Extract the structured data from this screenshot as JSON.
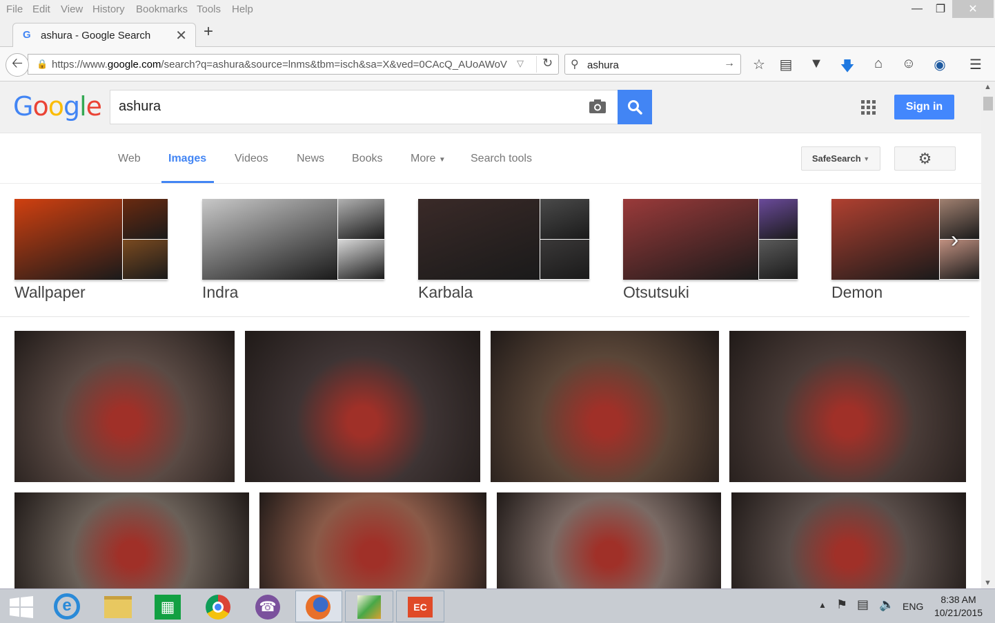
{
  "browser": {
    "menu": [
      "File",
      "Edit",
      "View",
      "History",
      "Bookmarks",
      "Tools",
      "Help"
    ],
    "tab_title": "ashura - Google Search",
    "url": "https://www.google.com/search?q=ashura&source=lnms&tbm=isch&sa=X&ved=0CAcQ_AUoAWoV",
    "url_prefix": "https://www.",
    "url_domain": "google.com",
    "url_rest": "/search?q=ashura&source=lnms&tbm=isch&sa=X&ved=0CAcQ_AUoAWoV",
    "search_value": "ashura"
  },
  "google": {
    "logo_letters": [
      "G",
      "o",
      "o",
      "g",
      "l",
      "e"
    ],
    "query": "ashura",
    "sign_in": "Sign in",
    "tabs": [
      "Web",
      "Images",
      "Videos",
      "News",
      "Books",
      "More",
      "Search tools"
    ],
    "active_tab": "Images",
    "safesearch": "SafeSearch",
    "collections": [
      {
        "label": "Wallpaper",
        "colors": [
          "#d04010",
          "#6a2a10",
          "#7a4a20"
        ]
      },
      {
        "label": "Indra",
        "colors": [
          "#c8c8c8",
          "#b0b0b0",
          "#d8d8d8"
        ]
      },
      {
        "label": "Karbala",
        "colors": [
          "#3a2a28",
          "#4a4a4a",
          "#3a3838"
        ]
      },
      {
        "label": "Otsutsuki",
        "colors": [
          "#9a3a3a",
          "#6a4a9a",
          "#5a5a5a"
        ]
      },
      {
        "label": "Demon",
        "colors": [
          "#b04030",
          "#a08070",
          "#c09080"
        ]
      }
    ],
    "results_row1": [
      "#5a4a44",
      "#3e3434",
      "#5a4638",
      "#4a3c38"
    ],
    "results_row2": [
      "#6a6058",
      "#8a5a48",
      "#7a6a64",
      "#5a4e4a"
    ]
  },
  "taskbar": {
    "time": "8:38 AM",
    "date": "10/21/2015",
    "language": "ENG"
  }
}
